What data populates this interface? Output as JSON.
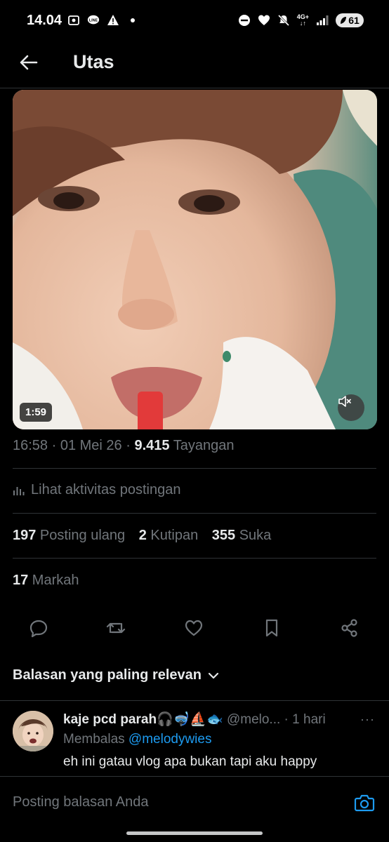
{
  "status_bar": {
    "time": "14.04",
    "left_icons": [
      "screenshot-icon",
      "line-app-icon",
      "warning-icon",
      "dot-icon"
    ],
    "right_icons": [
      "do-not-disturb-icon",
      "heart-icon",
      "mute-icon",
      "network-4g-icon",
      "signal-icon"
    ],
    "network_label": "4G+",
    "battery": "61"
  },
  "header": {
    "title": "Utas",
    "back_icon": "arrow-left-icon"
  },
  "media": {
    "duration": "1:59",
    "mute_icon": "volume-muted-icon"
  },
  "post_meta": {
    "time": "16:58",
    "sep1": " · ",
    "date": "01 Mei 26",
    "sep2": " · ",
    "views": "9.415",
    "views_label": " Tayangan"
  },
  "activity": {
    "label": "Lihat aktivitas postingan",
    "icon": "analytics-icon"
  },
  "stats": {
    "reposts": "197",
    "reposts_label": " Posting ulang",
    "quotes": "2",
    "quotes_label": " Kutipan",
    "likes": "355",
    "likes_label": " Suka",
    "bookmarks": "17",
    "bookmarks_label": " Markah"
  },
  "actions": [
    "reply-icon",
    "repost-icon",
    "like-icon",
    "bookmark-icon",
    "share-icon"
  ],
  "replies_sort": {
    "label": "Balasan yang paling relevan",
    "icon": "chevron-down-icon"
  },
  "reply": {
    "name": "kaje pcd parah🎧🤿⛵🐟",
    "handle": " @melo...",
    "sep": " · ",
    "time": "1 hari",
    "replying_prefix": "Membalas ",
    "replying_to": "@melodywies",
    "text": "eh ini gatau vlog apa bukan tapi aku happy"
  },
  "composer": {
    "placeholder": "Posting balasan Anda",
    "camera_icon": "camera-icon"
  },
  "colors": {
    "background": "#000000",
    "text_primary": "#e7e9ea",
    "text_secondary": "#71767b",
    "divider": "#2f3336",
    "accent": "#1d9bf0"
  }
}
